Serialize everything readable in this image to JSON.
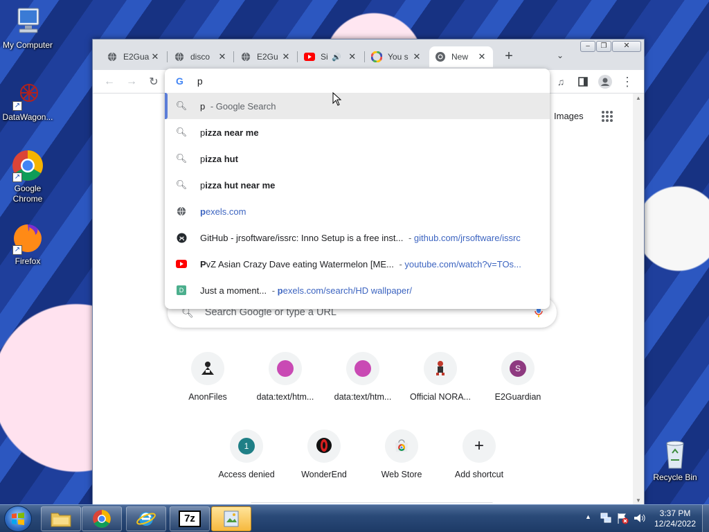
{
  "desktop": {
    "icons": [
      {
        "label": "My Computer"
      },
      {
        "label": "DataWagon..."
      },
      {
        "label": "Google Chrome"
      },
      {
        "label": "Firefox"
      },
      {
        "label": "Recycle Bin"
      }
    ]
  },
  "browser": {
    "tabs": [
      {
        "title": "E2Gua"
      },
      {
        "title": "disco"
      },
      {
        "title": "E2Gu"
      },
      {
        "title": "Si"
      },
      {
        "title": "You s"
      },
      {
        "title": "New"
      }
    ],
    "new_tab_symbol": "+",
    "tab_close_symbol": "✕",
    "omnibox": {
      "value": "p",
      "suggestions": [
        {
          "prefix": "p",
          "rest": "",
          "suffix": " - Google Search",
          "url": "",
          "icon": "search-icon"
        },
        {
          "prefix": "p",
          "rest": "izza near me",
          "suffix": "",
          "url": "",
          "icon": "search-icon"
        },
        {
          "prefix": "p",
          "rest": "izza hut",
          "suffix": "",
          "url": "",
          "icon": "search-icon"
        },
        {
          "prefix": "p",
          "rest": "izza hut near me",
          "suffix": "",
          "url": "",
          "icon": "search-icon"
        },
        {
          "prefix": "p",
          "rest": "exels.com",
          "suffix": "",
          "url": "",
          "icon": "globe-icon"
        },
        {
          "prefix": "",
          "rest": "GitHub - jrsoftware/issrc: Inno Setup is a free inst...",
          "suffix": " - ",
          "url": "github.com/jrsoftware/issrc",
          "icon": "github-icon"
        },
        {
          "prefix": "P",
          "rest": "vZ Asian Crazy Dave eating Watermelon [ME...",
          "suffix": " - ",
          "url": "youtube.com/watch?v=TOs...",
          "icon": "youtube-icon"
        },
        {
          "prefix": "",
          "rest": "Just a moment...",
          "suffix": " - ",
          "url_prefix": "p",
          "url": "exels.com/search/HD wallpaper/",
          "icon": "d-site-icon"
        }
      ]
    },
    "ntp": {
      "images_link": "Images",
      "search_placeholder": "Search Google or type a URL",
      "shortcuts": [
        {
          "label": "AnonFiles"
        },
        {
          "label": "data:text/htm..."
        },
        {
          "label": "data:text/htm..."
        },
        {
          "label": "Official NORA..."
        },
        {
          "label": "E2Guardian",
          "letter": "S"
        },
        {
          "label": "Access denied",
          "letter": "1"
        },
        {
          "label": "WonderEnd"
        },
        {
          "label": "Web Store"
        },
        {
          "label": "Add shortcut",
          "letter": "+"
        }
      ]
    }
  },
  "taskbar": {
    "clock_time": "3:37 PM",
    "clock_date": "12/24/2022",
    "apps": [
      "explorer",
      "chrome",
      "ie",
      "7-zip",
      "folder"
    ],
    "app_7z_label": "7z"
  },
  "colors": {
    "accent": "#5b7dd8",
    "url_blue": "#3c64c0",
    "youtube_red": "#ff0000",
    "shortcut_magenta": "#c94ab4",
    "e2guardian_purple": "#8e3a80",
    "teal": "#1f7f86"
  }
}
